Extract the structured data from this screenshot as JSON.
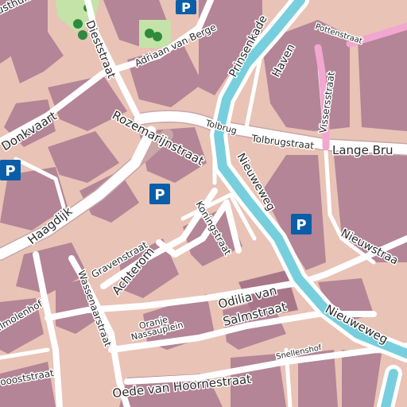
{
  "street_labels": {
    "diestsstraat": "Dieststraat",
    "adriaan": "Adriaan van Berge",
    "prinsenkade": "Prinsenkade",
    "haven": "Haven",
    "pottenstraat": "Pottenstraat",
    "donkvaart": "Donkvaart",
    "rozemarijnstraat": "Rozemarijnstraat",
    "tolbrug": "Tolbrug",
    "tolbrugstraat": "Tolbrugstraat",
    "lange_brug": "Lange Bru",
    "vissersstraat": "Vissersstraat",
    "nieuweweg": "Nieuweweg",
    "haagdijk": "Haagdijk",
    "koningstraat": "Koningstraat",
    "nieuwstraat": "Nieuwstraa",
    "gravenstraat": "Gravenstraat",
    "achterom": "Achterom",
    "wassenaarstraat": "Wassenaarstraat",
    "molenhof": "elmolenhof",
    "odilia_line1": "Odilia van",
    "odilia_line2": "Salmstraat",
    "oranje_nassau_line1": "Oranje",
    "oranje_nassau_line2": "Nassauplein",
    "nieuwewegbr": "Nieuweweg",
    "snellenshof": "Snellenshof",
    "oede": "Oede van Hoornestraat",
    "voost": "voooststraat",
    "husthuis": "usthuiss"
  },
  "parking": {
    "symbol": "P"
  },
  "colors": {
    "land": "#e9c3b6",
    "buildings": "#b48596",
    "roads": "#ffffff",
    "water": "#77cfdd",
    "park": "#c4e3a9",
    "pedestrian_road": "#f1a7cf",
    "parking": "#0a5ea8"
  }
}
